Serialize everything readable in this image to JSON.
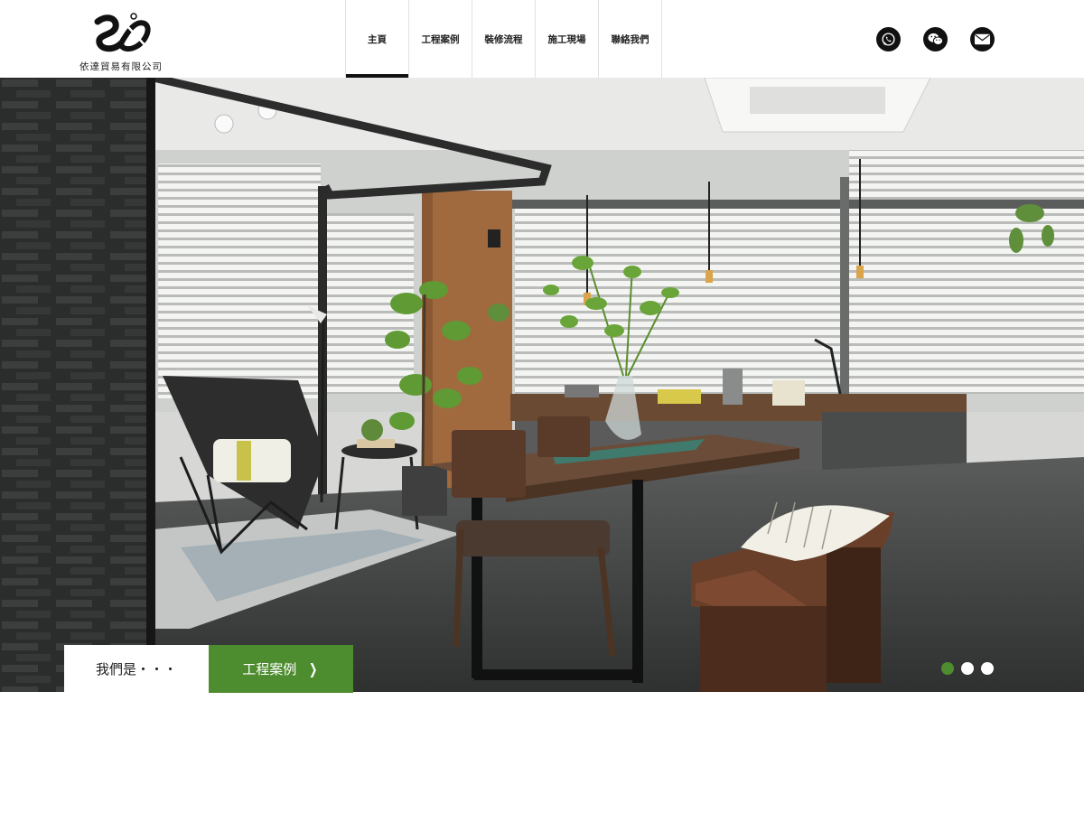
{
  "brand": {
    "name": "依達貿易有限公司"
  },
  "nav": {
    "items": [
      {
        "label": "主頁",
        "active": true
      },
      {
        "label": "工程案例",
        "active": false
      },
      {
        "label": "裝修流程",
        "active": false
      },
      {
        "label": "施工現場",
        "active": false
      },
      {
        "label": "聯絡我們",
        "active": false
      }
    ]
  },
  "socials": [
    {
      "icon": "whatsapp-icon"
    },
    {
      "icon": "wechat-icon"
    },
    {
      "icon": "mail-icon"
    }
  ],
  "hero": {
    "cta_about": "我們是・・・",
    "cta_cases": "工程案例",
    "slides": {
      "count": 3,
      "active": 0
    }
  },
  "colors": {
    "accent": "#4e8d2f",
    "text": "#222222",
    "header_bg": "#ffffff"
  }
}
